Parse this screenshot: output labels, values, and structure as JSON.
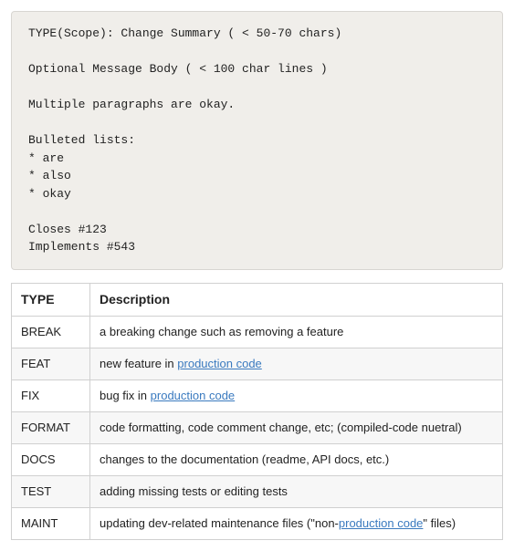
{
  "code_block": {
    "line1": "TYPE(Scope): Change Summary ( < 50-70 chars)",
    "line2": "Optional Message Body ( < 100 char lines )",
    "line3": "Multiple paragraphs are okay.",
    "line4": "Bulleted lists:",
    "line5": "* are",
    "line6": "* also",
    "line7": "* okay",
    "line8": "Closes #123",
    "line9": "Implements #543"
  },
  "table": {
    "header_type": "TYPE",
    "header_desc": "Description",
    "rows": {
      "r0_type": "BREAK",
      "r0_desc": "a breaking change such as removing a feature",
      "r1_type": "FEAT",
      "r1_desc_pre": "new feature in ",
      "r1_link": "production code",
      "r2_type": "FIX",
      "r2_desc_pre": "bug fix in ",
      "r2_link": "production code",
      "r3_type": "FORMAT",
      "r3_desc": "code formatting, code comment change, etc; (compiled-code nuetral)",
      "r4_type": "DOCS",
      "r4_desc": "changes to the documentation (readme, API docs, etc.)",
      "r5_type": "TEST",
      "r5_desc": "adding missing tests or editing tests",
      "r6_type": "MAINT",
      "r6_desc_pre": "updating dev-related maintenance files (\"non-",
      "r6_link": "production code",
      "r6_desc_post": "\" files)"
    }
  }
}
